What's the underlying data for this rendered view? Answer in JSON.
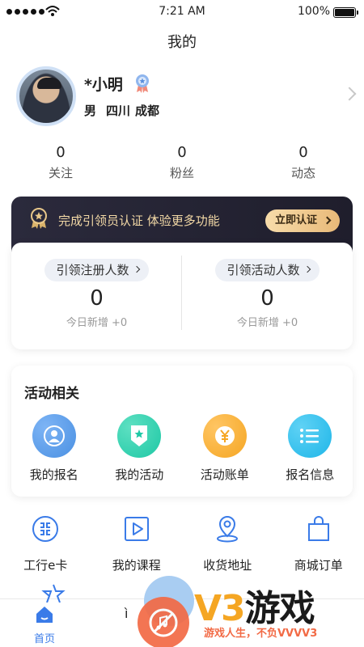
{
  "status_bar": {
    "time": "7:21 AM",
    "battery": "100%"
  },
  "page_title": "我的",
  "profile": {
    "name": "*小明",
    "gender": "男",
    "province": "四川",
    "city": "成都"
  },
  "stats": [
    {
      "value": "0",
      "label": "关注"
    },
    {
      "value": "0",
      "label": "粉丝"
    },
    {
      "value": "0",
      "label": "动态"
    }
  ],
  "certification": {
    "text": "完成引领员认证 体验更多功能",
    "button": "立即认证"
  },
  "invite": {
    "left": {
      "label": "引领注册人数",
      "value": "0",
      "today": "今日新增 +0"
    },
    "right": {
      "label": "引领活动人数",
      "value": "0",
      "today": "今日新增 +0"
    }
  },
  "activity": {
    "title": "活动相关",
    "items": [
      {
        "label": "我的报名",
        "icon": "user-icon",
        "color": "#4a90e2"
      },
      {
        "label": "我的活动",
        "icon": "medal-icon",
        "color": "#1ec8a5"
      },
      {
        "label": "活动账单",
        "icon": "yen-icon",
        "color": "#f5a623"
      },
      {
        "label": "报名信息",
        "icon": "list-icon",
        "color": "#1fb6e8"
      }
    ]
  },
  "tools": [
    {
      "label": "工行e卡",
      "icon": "card-icon"
    },
    {
      "label": "我的课程",
      "icon": "play-icon"
    },
    {
      "label": "收货地址",
      "icon": "location-icon"
    },
    {
      "label": "商城订单",
      "icon": "shopping-bag-icon"
    }
  ],
  "tabbar": {
    "home": "首页"
  },
  "watermark": {
    "brand_v3": "V3",
    "brand_game": "游戏",
    "slogan": "游戏人生，不负VVVV3"
  },
  "colors": {
    "accent": "#3a7be8",
    "banner_bg": "#2b2a3c",
    "gold": "#e8b978"
  }
}
